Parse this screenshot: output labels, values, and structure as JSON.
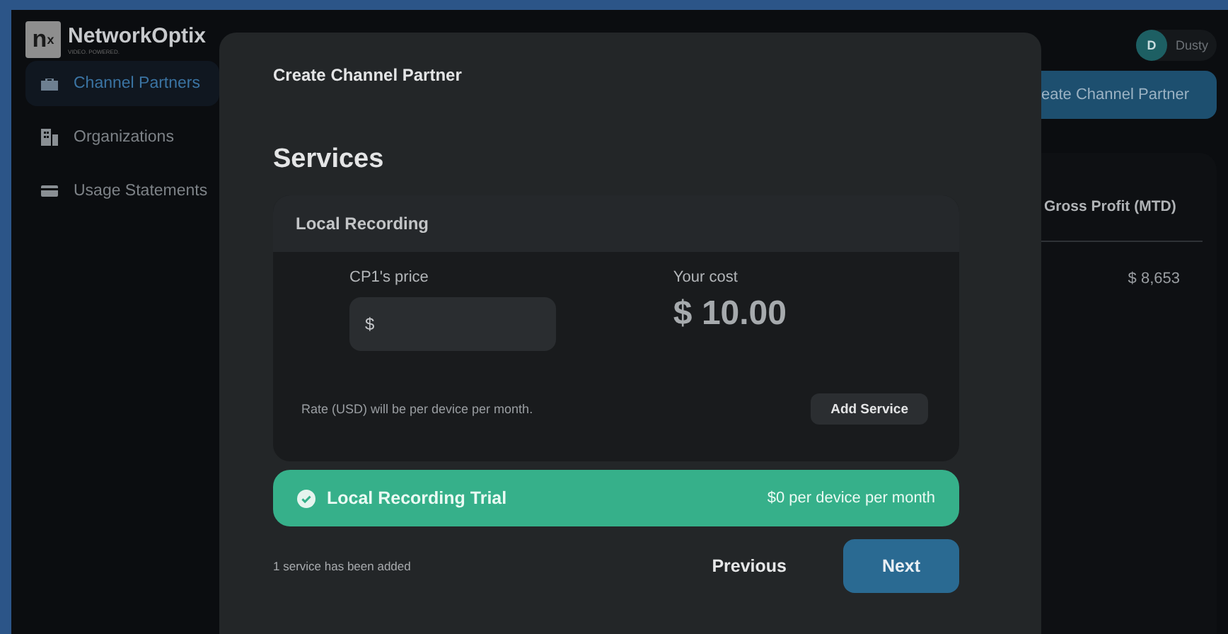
{
  "brand": {
    "name": "NetworkOptix",
    "tagline": "VIDEO. POWERED.",
    "logo_letter": "n",
    "logo_sup": "x"
  },
  "sidebar": {
    "items": [
      {
        "label": "Channel Partners",
        "kind": "partners",
        "selected": true
      },
      {
        "label": "Organizations",
        "kind": "organizations",
        "selected": false
      },
      {
        "label": "Usage Statements",
        "kind": "statements",
        "selected": false
      }
    ]
  },
  "user": {
    "initial": "D",
    "name": "Dusty"
  },
  "background": {
    "create_button": "eate Channel Partner",
    "table": {
      "column": "Gross Profit (MTD)",
      "value": "$ 8,653"
    }
  },
  "modal": {
    "title": "Create Channel Partner",
    "heading": "Services",
    "service": {
      "name": "Local Recording",
      "price_label": "CP1's price",
      "price_prefix": "$",
      "cost_label": "Your cost",
      "cost": "$ 10.00",
      "note": "Rate (USD) will be per device per month.",
      "add_button": "Add Service"
    },
    "added": [
      {
        "name": "Local Recording Trial",
        "rate": "$0 per device per month",
        "checked": true
      }
    ],
    "status": "1 service has been added",
    "previous": "Previous",
    "next": "Next"
  }
}
